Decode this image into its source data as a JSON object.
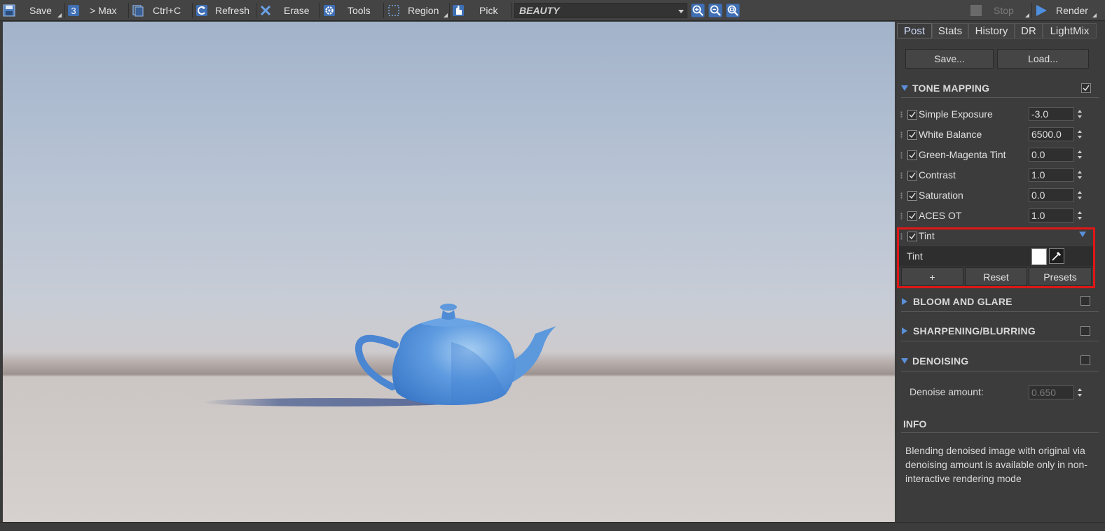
{
  "toolbar": {
    "save_label": "Save",
    "max_label": "> Max",
    "copy_label": "Ctrl+C",
    "refresh_label": "Refresh",
    "erase_label": "Erase",
    "tools_label": "Tools",
    "region_label": "Region",
    "pick_label": "Pick",
    "channel_value": "BEAUTY",
    "stop_label": "Stop",
    "render_label": "Render",
    "icons": [
      "save-icon",
      "history-3-icon",
      "copy-icon",
      "refresh-icon",
      "erase-icon",
      "gear-icon",
      "region-icon",
      "pick-hand-icon",
      "zoom-in-icon",
      "zoom-out-icon",
      "zoom-fit-icon",
      "stop-icon",
      "play-icon"
    ]
  },
  "panel": {
    "tabs": [
      "Post",
      "Stats",
      "History",
      "DR",
      "LightMix"
    ],
    "active_tab": "Post",
    "save_btn": "Save...",
    "load_btn": "Load...",
    "tone_mapping": {
      "title": "TONE MAPPING",
      "enabled": true,
      "rows": [
        {
          "label": "Simple Exposure",
          "value": "-3.0"
        },
        {
          "label": "White Balance",
          "value": "6500.0"
        },
        {
          "label": "Green-Magenta Tint",
          "value": "0.0"
        },
        {
          "label": "Contrast",
          "value": "1.0"
        },
        {
          "label": "Saturation",
          "value": "0.0"
        },
        {
          "label": "ACES OT",
          "value": "1.0"
        }
      ],
      "tint": {
        "header": "Tint",
        "row_label": "Tint",
        "color": "#ffffff",
        "add_btn": "+",
        "reset_btn": "Reset",
        "presets_btn": "Presets"
      }
    },
    "bloom": {
      "title": "BLOOM AND GLARE"
    },
    "sharpening": {
      "title": "SHARPENING/BLURRING"
    },
    "denoising": {
      "title": "DENOISING",
      "amount_label": "Denoise amount:",
      "amount_value": "0.650"
    },
    "info": {
      "title": "INFO",
      "text": "Blending denoised image with original via denoising amount is available only in non-interactive rendering mode"
    }
  },
  "colors": {
    "accent": "#5b8fd8",
    "highlight_border": "#e01616",
    "teapot": "#4e8fd6"
  }
}
